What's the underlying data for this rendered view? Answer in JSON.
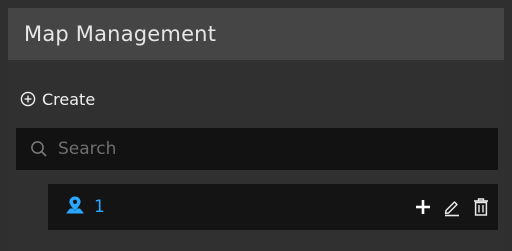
{
  "panel": {
    "title": "Map Management"
  },
  "toolbar": {
    "create_label": "Create",
    "create_icon": "plus-circle-icon"
  },
  "search": {
    "placeholder": "Search",
    "value": "",
    "icon": "search-icon"
  },
  "maps": [
    {
      "label": "1",
      "icon": "map-marker-icon",
      "actions": [
        "add-icon",
        "edit-icon",
        "delete-icon"
      ]
    }
  ],
  "colors": {
    "accent": "#2aa7ff",
    "header_bg": "#454545",
    "panel_bg": "#303030",
    "field_bg": "#121212"
  }
}
